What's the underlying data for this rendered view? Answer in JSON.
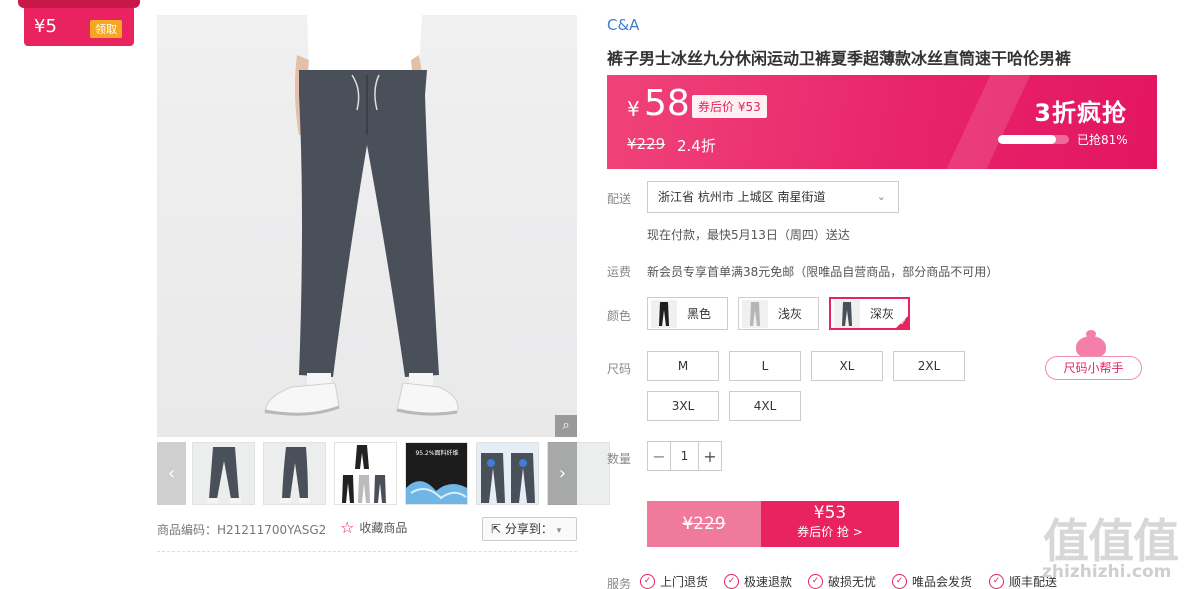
{
  "coupon": {
    "amount": "¥5",
    "action": "领取"
  },
  "gallery": {
    "prev_arrow": "‹",
    "next_arrow": "›",
    "zoom_icon": "magnifier-icon",
    "thumb_label": "95.2%面料纤维",
    "sku": "商品编码：H21211700YASG2",
    "favorite": "收藏商品",
    "share": "分享到："
  },
  "product": {
    "brand": "C&A",
    "title": "裤子男士冰丝九分休闲运动卫裤夏季超薄款冰丝直筒速干哈伦男裤"
  },
  "price": {
    "currency": "¥",
    "current": "58",
    "after_coupon": "券后价 ¥53",
    "original": "¥229",
    "discount": "2.4折",
    "promo_title": "3折疯抢",
    "sold_text": "已抢81%",
    "sold_percent": 81
  },
  "shipping": {
    "label": "配送",
    "address": "浙江省 杭州市 上城区 南星街道",
    "eta": "现在付款，最快5月13日（周四）送达"
  },
  "freight": {
    "label": "运费",
    "text": "新会员专享首单满38元免邮（限唯品自营商品，部分商品不可用）"
  },
  "colors": {
    "label": "颜色",
    "options": [
      "黑色",
      "浅灰",
      "深灰"
    ],
    "selected": "深灰"
  },
  "sizes": {
    "label": "尺码",
    "options": [
      "M",
      "L",
      "XL",
      "2XL",
      "3XL",
      "4XL"
    ],
    "helper": "尺码小帮手"
  },
  "quantity": {
    "label": "数量",
    "value": "1",
    "minus": "−",
    "plus": "+"
  },
  "buy": {
    "original": "¥229",
    "price": "¥53",
    "action": "券后价 抢 >"
  },
  "services": {
    "label": "服务",
    "items": [
      "上门退货",
      "极速退款",
      "破损无忧",
      "唯品会发货",
      "顺丰配送"
    ]
  },
  "watermark": {
    "text": "值值值",
    "url": "zhizhizhi.com"
  }
}
